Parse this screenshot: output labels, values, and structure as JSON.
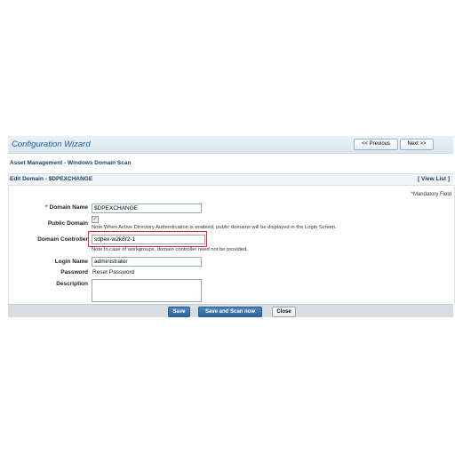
{
  "wizard": {
    "title": "Configuration Wizard",
    "prev_label": "<< Previous",
    "next_label": "Next >>"
  },
  "section": {
    "title": "Asset Management - Windows Domain Scan"
  },
  "edit_bar": {
    "title": "Edit Domain - $DPEXCHANGE",
    "view_list": "[ View List ]"
  },
  "form": {
    "mandatory_star": "*",
    "mandatory_note": "Mandatory Field",
    "domain_name": {
      "star": "*",
      "label": "Domain Name",
      "value": "$DPEXCHANGE"
    },
    "public_domain": {
      "label": "Public Domain",
      "checked": true,
      "note": "Note:When Active Directory Authentication is enabled, public domains will be displayed in the Login Screen."
    },
    "domain_controller": {
      "label": "Domain Controller",
      "value": "sdpex-w2k8r2-1",
      "note": "Note:In case of workgroups, domain controller need not be provided."
    },
    "login_name": {
      "label": "Login Name",
      "value": "administrator"
    },
    "password": {
      "label": "Password",
      "value": "Reset Password"
    },
    "description": {
      "label": "Description",
      "value": ""
    }
  },
  "buttons": {
    "save": "Save",
    "save_and_scan": "Save and Scan now",
    "close": "Close"
  },
  "colors": {
    "header_title": "#1d5b9a",
    "required_star": "#d00000",
    "highlight_outline": "#e0262b",
    "primary_button": "#2c619a"
  }
}
